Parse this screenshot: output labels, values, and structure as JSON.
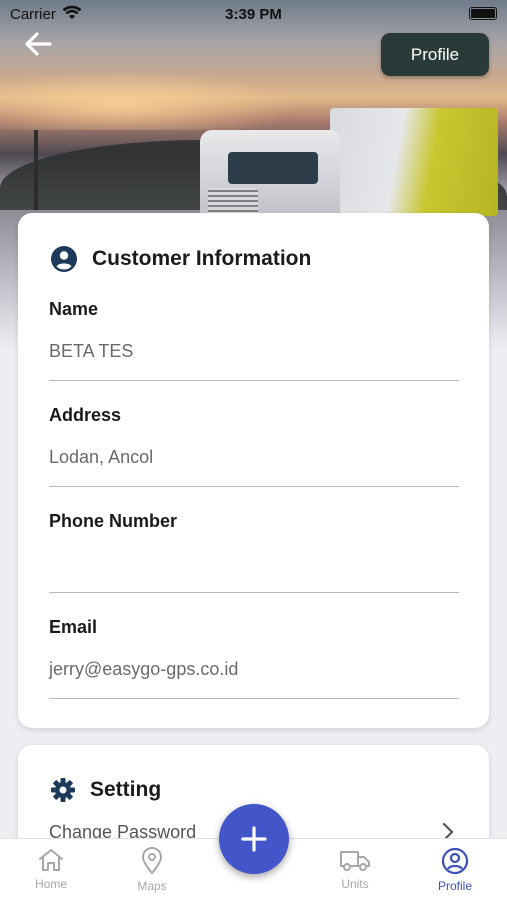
{
  "status_bar": {
    "carrier": "Carrier",
    "time": "3:39 PM"
  },
  "header": {
    "profile_button": "Profile"
  },
  "customer_info": {
    "title": "Customer Information",
    "fields": [
      {
        "label": "Name",
        "value": "BETA TES"
      },
      {
        "label": "Address",
        "value": "Lodan, Ancol"
      },
      {
        "label": "Phone Number",
        "value": ""
      },
      {
        "label": "Email",
        "value": "jerry@easygo-gps.co.id"
      }
    ]
  },
  "setting": {
    "title": "Setting",
    "change_password": "Change Password"
  },
  "tabbar": {
    "tabs": [
      {
        "label": "Home",
        "icon": "home-icon"
      },
      {
        "label": "Maps",
        "icon": "map-pin-icon"
      },
      {
        "label": "Units",
        "icon": "truck-icon"
      },
      {
        "label": "Profile",
        "icon": "user-circle-icon"
      }
    ],
    "active": "Profile"
  },
  "colors": {
    "accent": "#3d50b6",
    "fab": "#4356c9",
    "profile_button": "#2a3a38",
    "icon_dark": "#1d3a5a"
  }
}
